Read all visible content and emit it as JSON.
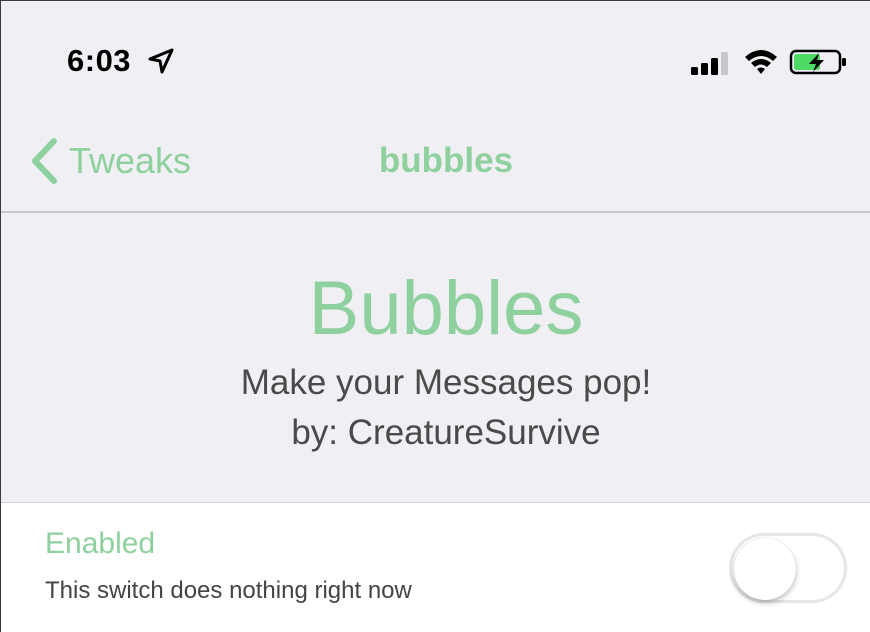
{
  "status_bar": {
    "time": "6:03",
    "location_icon": "location-arrow-icon",
    "signal_icon": "cellular-signal-icon",
    "wifi_icon": "wifi-icon",
    "battery_icon": "battery-charging-icon"
  },
  "nav": {
    "back_label": "Tweaks",
    "title": "bubbles"
  },
  "header": {
    "title": "Bubbles",
    "subtitle": "Make your Messages pop!",
    "author": "by: CreatureSurvive"
  },
  "settings": {
    "enabled_label": "Enabled",
    "enabled_description": "This switch does nothing right now",
    "enabled": false
  },
  "colors": {
    "accent": "#8fd19e",
    "background": "#efeff4",
    "battery_fill": "#4cd964"
  }
}
